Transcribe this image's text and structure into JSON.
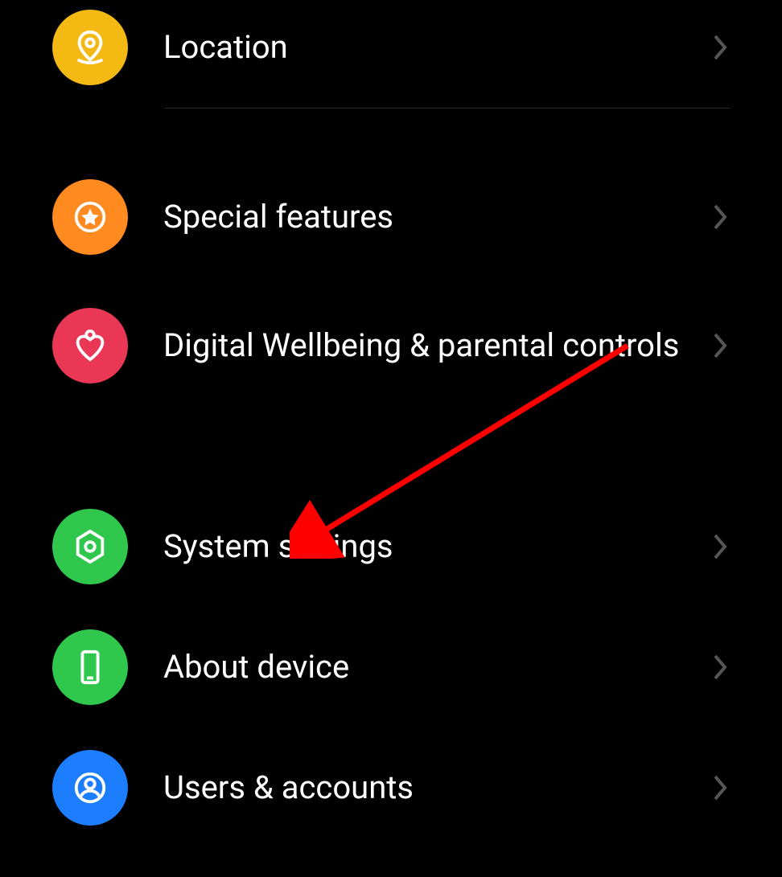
{
  "settings": {
    "items": [
      {
        "id": "location",
        "label": "Location",
        "icon": "location-pin-icon",
        "color": "yellow"
      },
      {
        "id": "special-features",
        "label": "Special features",
        "icon": "star-circle-icon",
        "color": "orange"
      },
      {
        "id": "digital-wellbeing",
        "label": "Digital Wellbeing & parental controls",
        "icon": "heart-person-icon",
        "color": "red"
      },
      {
        "id": "system-settings",
        "label": "System settings",
        "icon": "hexagon-gear-icon",
        "color": "green"
      },
      {
        "id": "about-device",
        "label": "About device",
        "icon": "phone-icon",
        "color": "green"
      },
      {
        "id": "users-accounts",
        "label": "Users & accounts",
        "icon": "user-circle-icon",
        "color": "blue"
      }
    ]
  },
  "annotation": {
    "type": "arrow",
    "target": "system-settings"
  }
}
